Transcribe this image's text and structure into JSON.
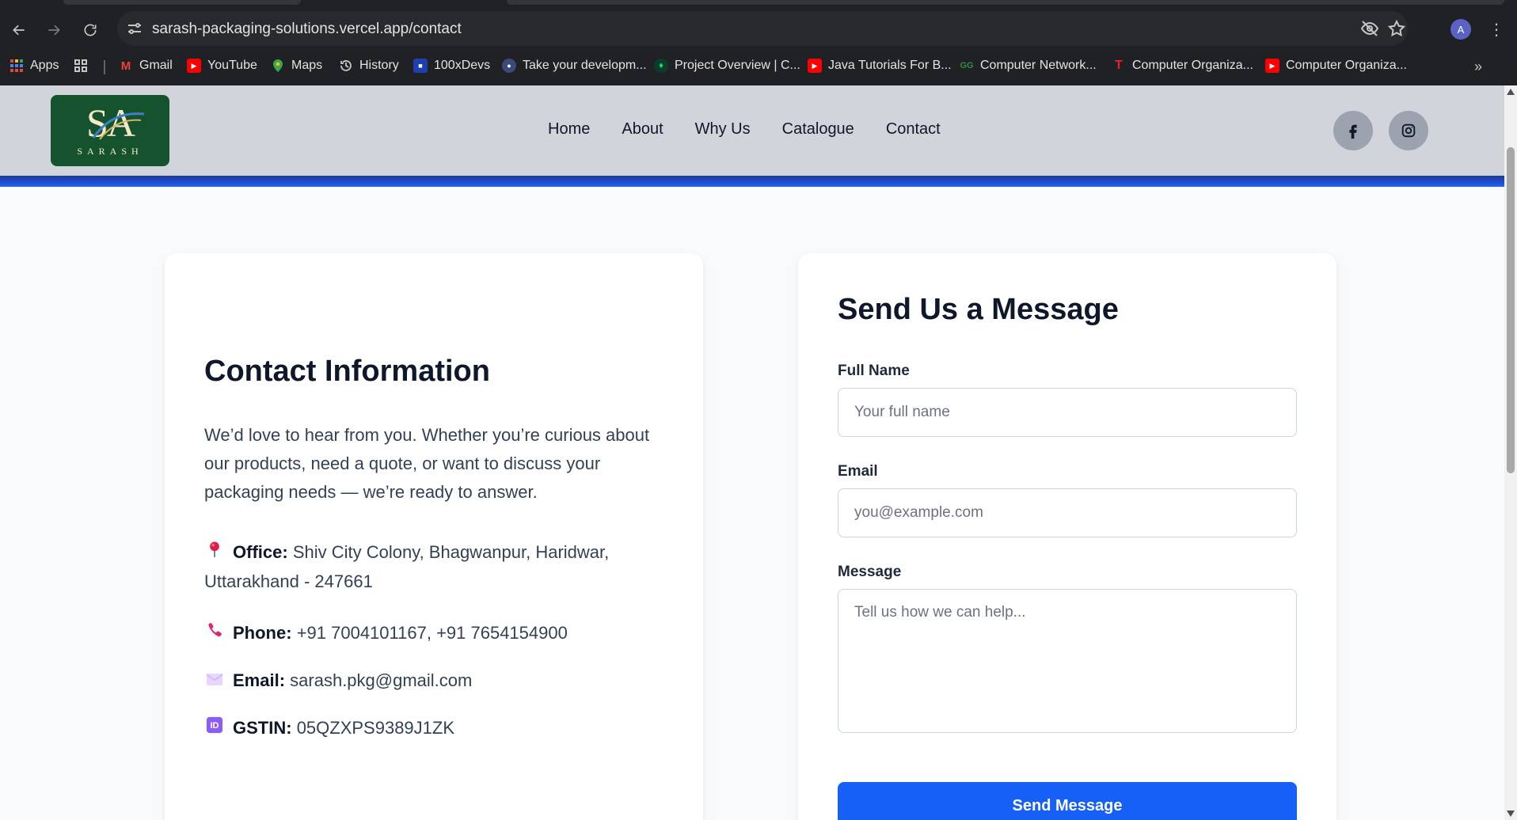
{
  "browser": {
    "url": "sarash-packaging-solutions.vercel.app/contact",
    "profile_initial": "A",
    "bookmarks": [
      {
        "label": "Apps",
        "icon": "apps-grid-icon"
      },
      {
        "label": "",
        "icon": "tab-groups-icon"
      },
      {
        "label": "Gmail",
        "icon": "gmail-icon"
      },
      {
        "label": "YouTube",
        "icon": "youtube-icon"
      },
      {
        "label": "Maps",
        "icon": "maps-icon"
      },
      {
        "label": "History",
        "icon": "history-icon"
      },
      {
        "label": "100xDevs",
        "icon": "100xdevs-icon"
      },
      {
        "label": "Take your developm...",
        "icon": "avatar-icon"
      },
      {
        "label": "Project Overview | C...",
        "icon": "mongodb-icon"
      },
      {
        "label": "Java Tutorials For B...",
        "icon": "youtube-icon"
      },
      {
        "label": "Computer Network...",
        "icon": "geeksforgeeks-icon"
      },
      {
        "label": "Computer Organiza...",
        "icon": "tesla-icon"
      },
      {
        "label": "Computer Organiza...",
        "icon": "youtube-icon"
      }
    ]
  },
  "header": {
    "logo_monogram": "SA",
    "logo_brand": "SARASH",
    "nav": [
      "Home",
      "About",
      "Why Us",
      "Catalogue",
      "Contact"
    ],
    "social": [
      "facebook-icon",
      "instagram-icon"
    ]
  },
  "contact_info": {
    "title": "Contact Information",
    "intro": "We’d love to hear from you. Whether you’re curious about our products, need a quote, or want to discuss your packaging needs — we’re ready to answer.",
    "office_label": "Office:",
    "office_value": "Shiv City Colony, Bhagwanpur, Haridwar, Uttarakhand - 247661",
    "phone_label": "Phone:",
    "phone_value": "+91 7004101167, +91 7654154900",
    "email_label": "Email:",
    "email_value": "sarash.pkg@gmail.com",
    "gstin_label": "GSTIN:",
    "gstin_value": "05QZXPS9389J1ZK"
  },
  "form": {
    "title": "Send Us a Message",
    "name_label": "Full Name",
    "name_placeholder": "Your full name",
    "email_label": "Email",
    "email_placeholder": "you@example.com",
    "message_label": "Message",
    "message_placeholder": "Tell us how we can help...",
    "submit_label": "Send Message"
  },
  "colors": {
    "accent": "#1760f5",
    "header_bg": "#d1d5db",
    "logo_bg": "#14532d"
  }
}
